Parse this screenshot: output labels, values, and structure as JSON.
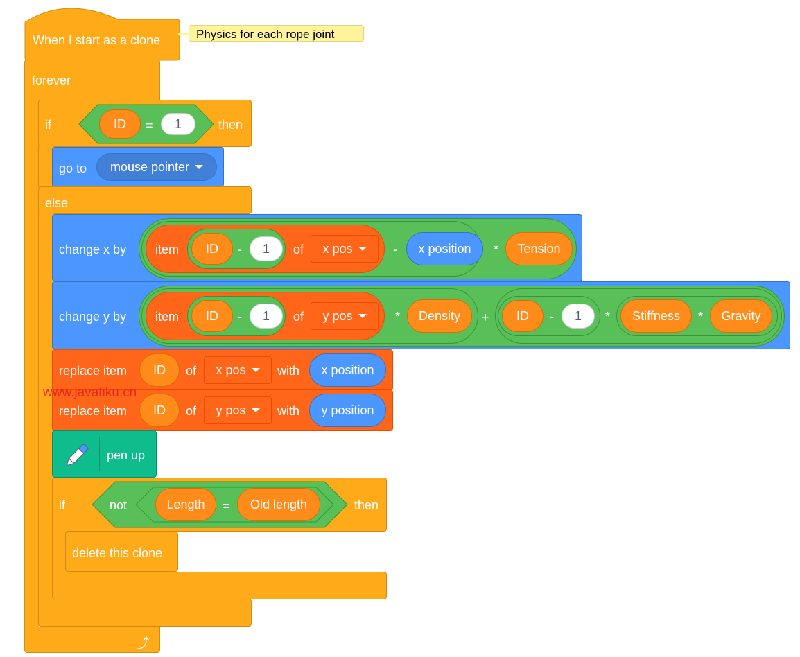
{
  "script": {
    "hat_label": "When I start as a clone",
    "comment": "Physics for each rope joint",
    "forever_label": "forever",
    "if1": {
      "if_label": "if",
      "then_label": "then",
      "cond": {
        "left": "ID",
        "op": "=",
        "right": "1"
      }
    },
    "goto": {
      "label": "go to",
      "target": "mouse pointer"
    },
    "else_label": "else",
    "change_x": {
      "label": "change x by",
      "item_label": "item",
      "index_var": "ID",
      "minus": "-",
      "index_num": "1",
      "of_label": "of",
      "list": "x pos",
      "minus2": "-",
      "reporter": "x position",
      "times": "*",
      "factor": "Tension"
    },
    "change_y": {
      "label": "change y by",
      "item_label": "item",
      "index_var": "ID",
      "minus": "-",
      "index_num": "1",
      "of_label": "of",
      "list": "y pos",
      "times": "*",
      "factor": "Density",
      "plus": "+",
      "var2": "ID",
      "minus2": "-",
      "num2": "1",
      "times2": "*",
      "factor2": "Stiffness",
      "times3": "*",
      "factor3": "Gravity"
    },
    "replace_x": {
      "label": "replace item",
      "index": "ID",
      "of_label": "of",
      "list": "x pos",
      "with_label": "with",
      "value": "x position"
    },
    "replace_y": {
      "label": "replace item",
      "index": "ID",
      "of_label": "of",
      "list": "y pos",
      "with_label": "with",
      "value": "y position"
    },
    "pen_up": {
      "label": "pen up",
      "icon": "pen-icon"
    },
    "if2": {
      "if_label": "if",
      "not_label": "not",
      "left": "Length",
      "op": "=",
      "right": "Old length",
      "then_label": "then"
    },
    "delete_clone": "delete this clone",
    "loop_icon": "loop-arrow-icon"
  },
  "watermark": "www.javatiku.cn",
  "colors": {
    "control": "#FFAB19",
    "motion": "#4C97FF",
    "list": "#FF661A",
    "variable": "#FF8C1A",
    "operator": "#59C059",
    "pen": "#0FBD8C",
    "comment": "#FEF49C"
  }
}
